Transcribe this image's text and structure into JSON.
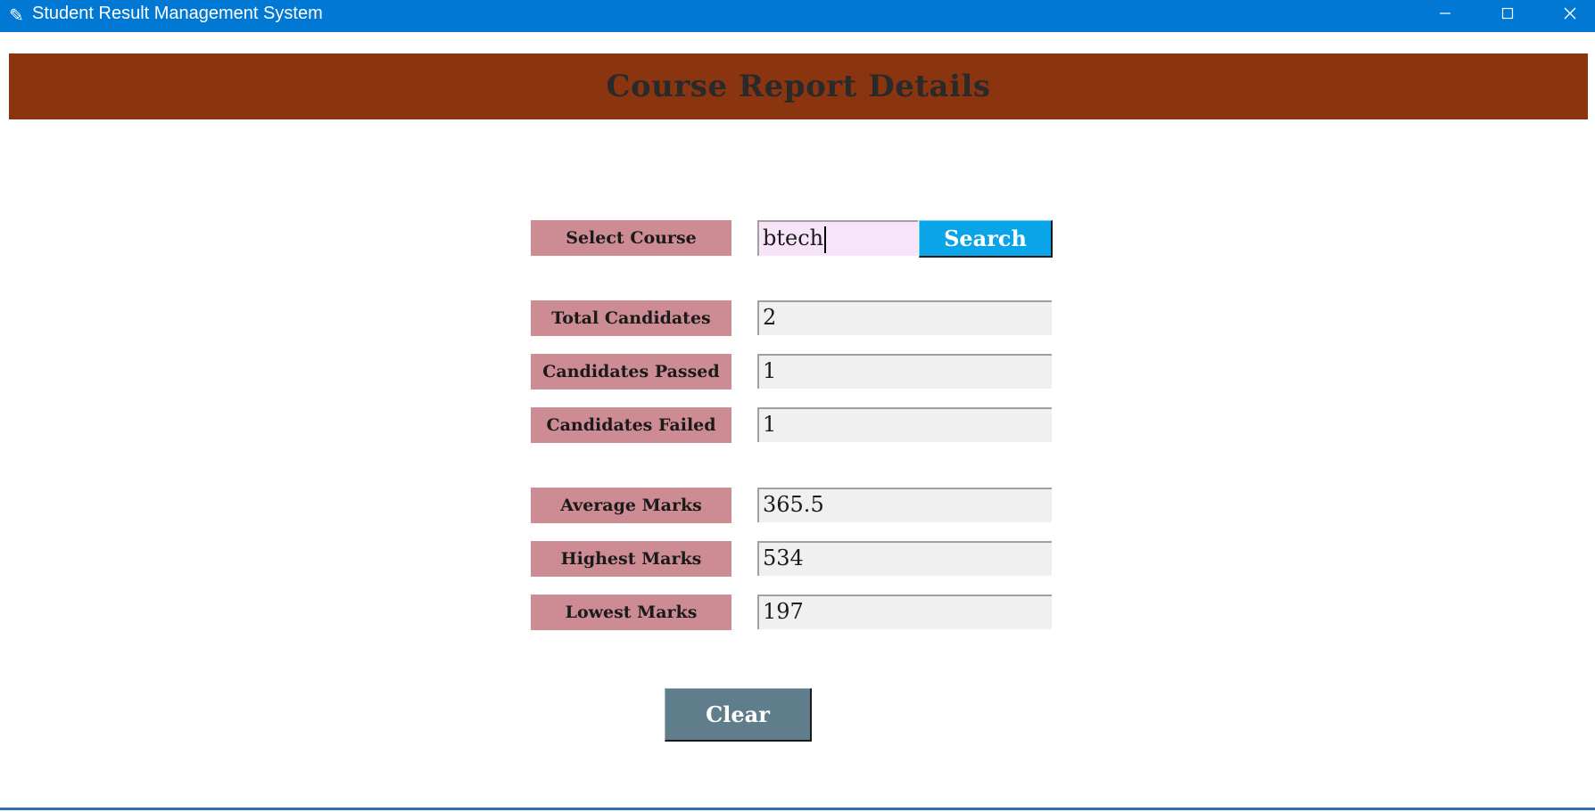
{
  "window": {
    "title": "Student Result Management System",
    "icon": "feather-icon",
    "controls": [
      "minimize-icon",
      "maximize-icon",
      "close-icon"
    ]
  },
  "header": {
    "title": "Course Report Details",
    "background": "#8b3510"
  },
  "course_search": {
    "label": "Select Course",
    "value": "btech",
    "button_label": "Search"
  },
  "report": {
    "total_candidates": {
      "label": "Total Candidates",
      "value": "2"
    },
    "candidates_passed": {
      "label": "Candidates Passed",
      "value": "1"
    },
    "candidates_failed": {
      "label": "Candidates Failed",
      "value": "1"
    },
    "average_marks": {
      "label": "Average Marks",
      "value": "365.5"
    },
    "highest_marks": {
      "label": "Highest Marks",
      "value": "534"
    },
    "lowest_marks": {
      "label": "Lowest Marks",
      "value": "197"
    }
  },
  "actions": {
    "clear_label": "Clear"
  },
  "colors": {
    "titlebar": "#0078d4",
    "label_bg": "#cd8b93",
    "search_button": "#0aa5e8",
    "clear_button": "#607d8b"
  }
}
